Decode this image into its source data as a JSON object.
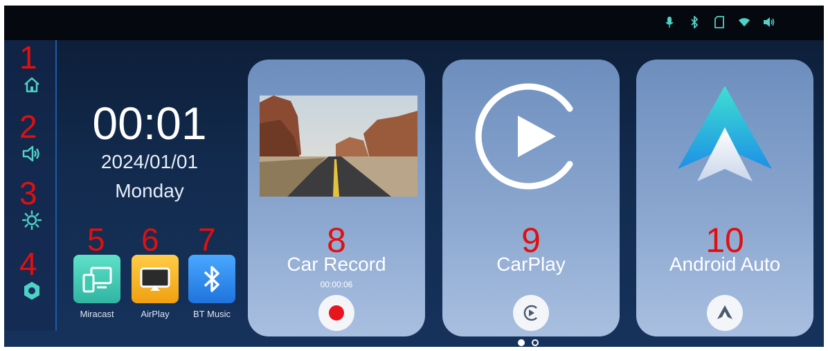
{
  "status_bar": {
    "icons": [
      "microphone-icon",
      "bluetooth-icon",
      "sd-card-icon",
      "wifi-icon",
      "volume-icon"
    ],
    "color": "#4fd1c5"
  },
  "sidebar": {
    "items": [
      {
        "number": "1",
        "icon": "home-icon"
      },
      {
        "number": "2",
        "icon": "volume-icon"
      },
      {
        "number": "3",
        "icon": "brightness-icon"
      },
      {
        "number": "4",
        "icon": "settings-icon"
      }
    ]
  },
  "clock": {
    "time": "00:01",
    "date": "2024/01/01",
    "day": "Monday"
  },
  "apps": [
    {
      "number": "5",
      "label": "Miracast",
      "icon": "miracast-icon",
      "color": "#3ec9b0"
    },
    {
      "number": "6",
      "label": "AirPlay",
      "icon": "airplay-icon",
      "color": "#f5b323"
    },
    {
      "number": "7",
      "label": "BT Music",
      "icon": "bluetooth-icon",
      "color": "#2f8ef0"
    }
  ],
  "cards": [
    {
      "number": "8",
      "title": "Car Record",
      "subtitle": "00:00:06",
      "icon": "road-thumbnail",
      "button": "record-icon"
    },
    {
      "number": "9",
      "title": "CarPlay",
      "subtitle": "",
      "icon": "carplay-icon",
      "button": "carplay-small-icon"
    },
    {
      "number": "10",
      "title": "Android Auto",
      "subtitle": "",
      "icon": "android-auto-icon",
      "button": "android-auto-small-icon"
    }
  ],
  "pagination": {
    "current": 1,
    "total": 2
  },
  "colors": {
    "annotation_red": "#e01010",
    "accent": "#4fd1c5",
    "record_red": "#e8141e"
  }
}
